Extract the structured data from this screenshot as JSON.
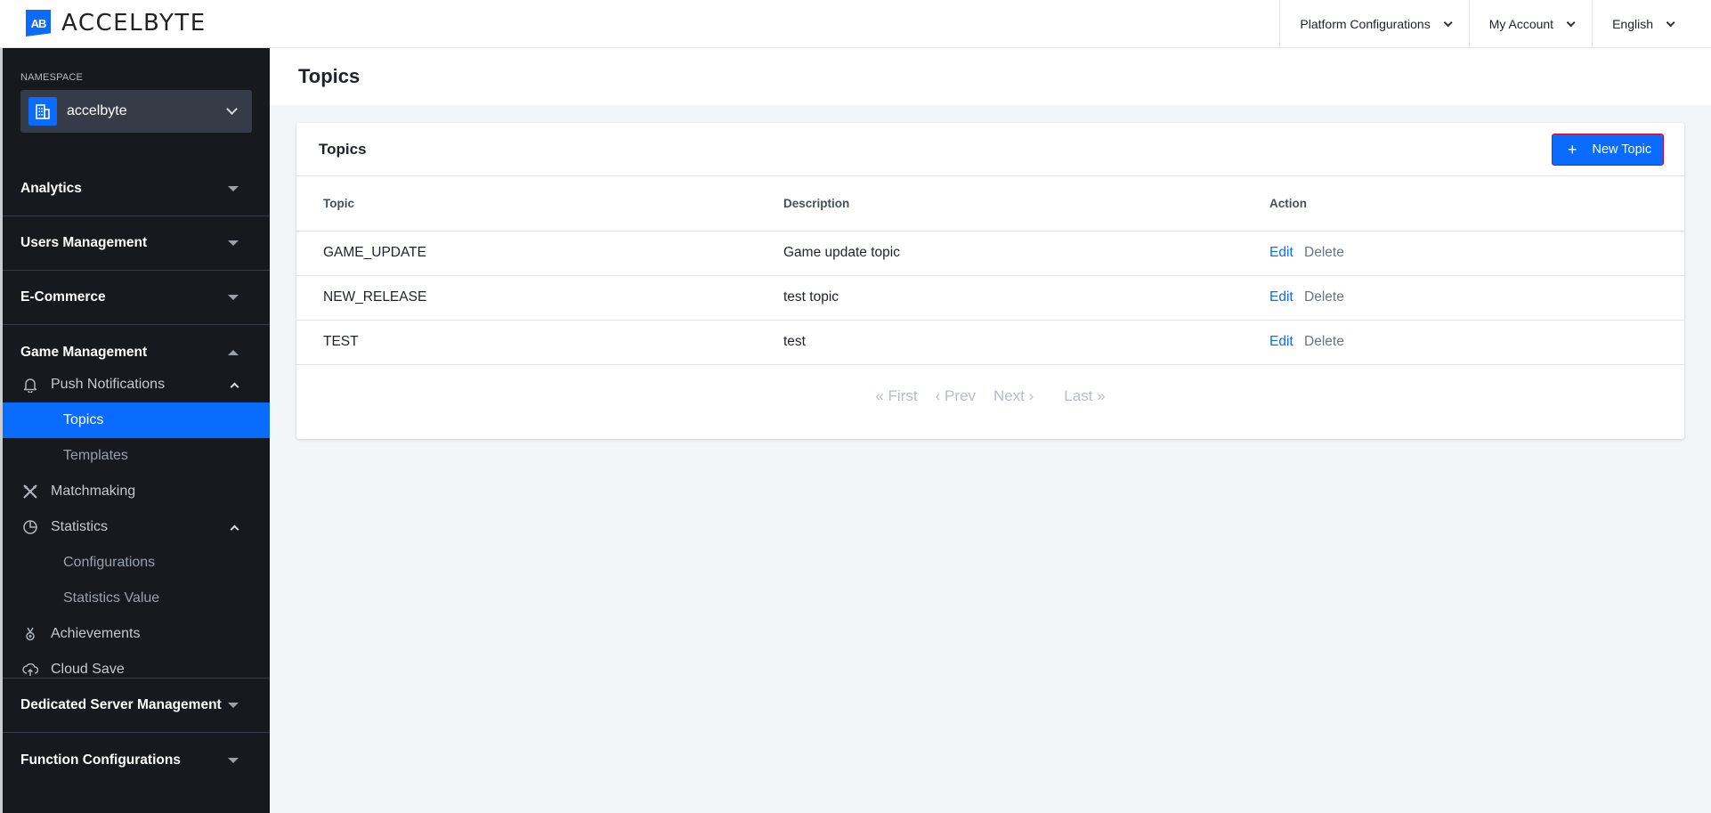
{
  "brand": {
    "logo_mark": "AB",
    "name": "ACCELBYTE"
  },
  "topnav": {
    "items": [
      {
        "label": "Platform Configurations"
      },
      {
        "label": "My Account"
      },
      {
        "label": "English"
      }
    ]
  },
  "sidebar": {
    "namespace_label": "NAMESPACE",
    "namespace_value": "accelbyte",
    "sections": [
      {
        "label": "Analytics",
        "state": "collapsed"
      },
      {
        "label": "Users Management",
        "state": "collapsed"
      },
      {
        "label": "E-Commerce",
        "state": "collapsed"
      },
      {
        "label": "Game Management",
        "state": "expanded"
      },
      {
        "label": "Dedicated Server Management",
        "state": "collapsed"
      },
      {
        "label": "Function Configurations",
        "state": "collapsed"
      }
    ],
    "game_management_items": {
      "push_notifications": {
        "label": "Push Notifications",
        "icon": "bell-icon",
        "subitems": [
          {
            "label": "Topics",
            "active": true
          },
          {
            "label": "Templates",
            "active": false
          }
        ]
      },
      "matchmaking": {
        "label": "Matchmaking",
        "icon": "crossed-swords-icon"
      },
      "statistics": {
        "label": "Statistics",
        "icon": "pie-chart-icon",
        "subitems": [
          {
            "label": "Configurations"
          },
          {
            "label": "Statistics Value"
          }
        ]
      },
      "achievements": {
        "label": "Achievements",
        "icon": "medal-icon"
      },
      "cloud_save": {
        "label": "Cloud Save",
        "icon": "cloud-upload-icon"
      }
    }
  },
  "page": {
    "title": "Topics"
  },
  "card": {
    "title": "Topics",
    "new_button": {
      "label": "New Topic",
      "icon": "plus-icon"
    },
    "columns": [
      "Topic",
      "Description",
      "Action"
    ],
    "rows": [
      {
        "topic": "GAME_UPDATE",
        "description": "Game update topic",
        "edit": "Edit",
        "delete": "Delete"
      },
      {
        "topic": "NEW_RELEASE",
        "description": "test topic",
        "edit": "Edit",
        "delete": "Delete"
      },
      {
        "topic": "TEST",
        "description": "test",
        "edit": "Edit",
        "delete": "Delete"
      }
    ],
    "pagination": {
      "first": "« First",
      "prev": "‹ Prev",
      "next": "Next ›",
      "last": "Last »"
    }
  },
  "colors": {
    "accent": "#0a6cff",
    "sidebar_bg": "#16191e",
    "namespace_bg": "#353c47",
    "pager_disabled": "#b5bdca",
    "highlight_border": "#e0001a"
  }
}
